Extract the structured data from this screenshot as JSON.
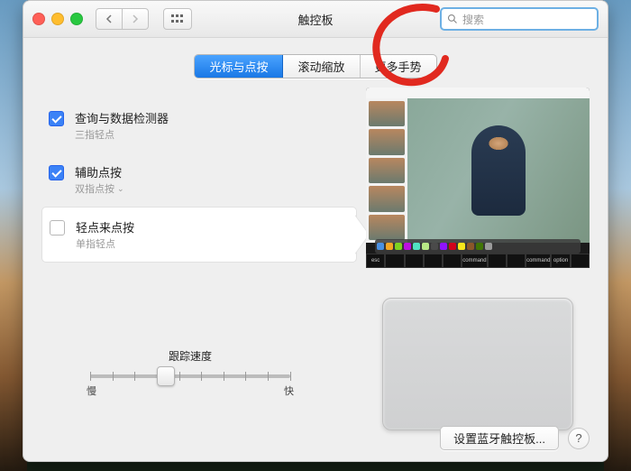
{
  "window": {
    "title": "触控板",
    "search_placeholder": "搜索"
  },
  "tabs": {
    "point_click": "光标与点按",
    "scroll_zoom": "滚动缩放",
    "more_gestures": "更多手势"
  },
  "options": {
    "lookup": {
      "title": "查询与数据检测器",
      "sub": "三指轻点",
      "checked": true
    },
    "secondary": {
      "title": "辅助点按",
      "sub": "双指点按",
      "checked": true,
      "has_dropdown": true
    },
    "tap": {
      "title": "轻点来点按",
      "sub": "单指轻点",
      "checked": false,
      "selected": true
    }
  },
  "slider": {
    "label": "跟踪速度",
    "slow": "慢",
    "fast": "快",
    "value": 4,
    "max": 10
  },
  "touchbar_keys": [
    "esc",
    "",
    "",
    "",
    "",
    "command",
    "",
    "",
    "command",
    "option",
    ""
  ],
  "footer": {
    "bluetooth": "设置蓝牙触控板...",
    "help": "?"
  }
}
